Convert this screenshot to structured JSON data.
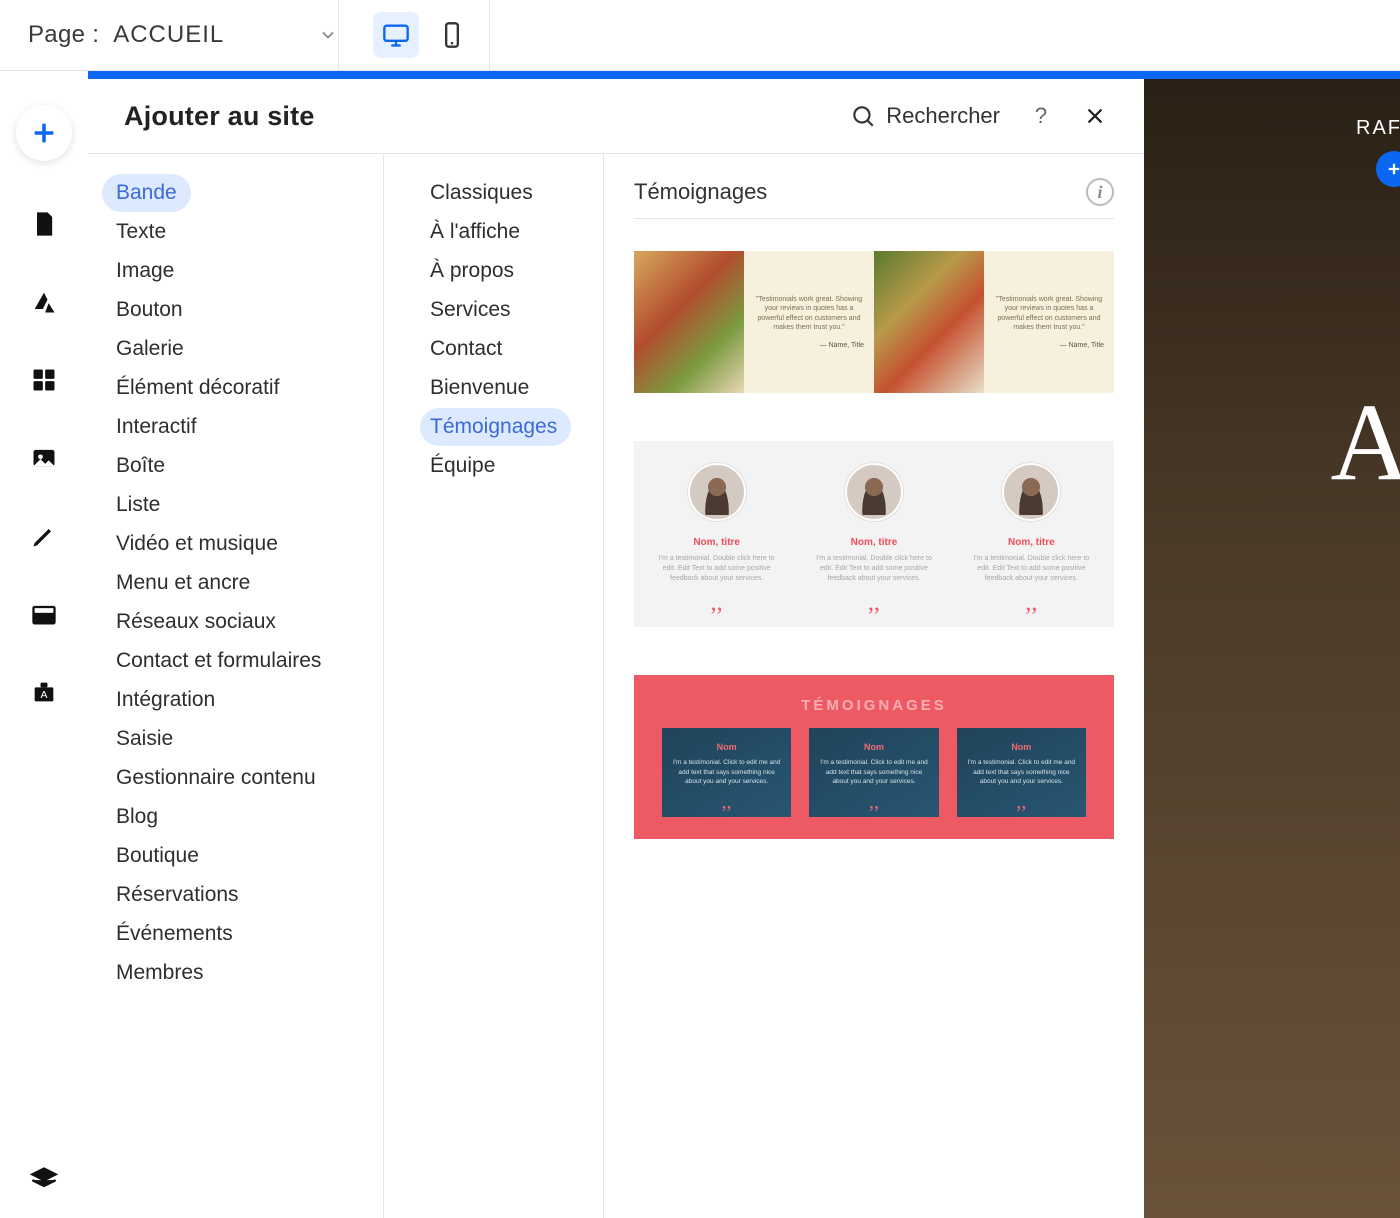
{
  "topbar": {
    "page_label": "Page :",
    "page_value": "ACCUEIL"
  },
  "panel": {
    "title": "Ajouter au site",
    "search_label": "Rechercher"
  },
  "categories": [
    "Bande",
    "Texte",
    "Image",
    "Bouton",
    "Galerie",
    "Élément décoratif",
    "Interactif",
    "Boîte",
    "Liste",
    "Vidéo et musique",
    "Menu et ancre",
    "Réseaux sociaux",
    "Contact et formulaires",
    "Intégration",
    "Saisie",
    "Gestionnaire contenu",
    "Blog",
    "Boutique",
    "Réservations",
    "Événements",
    "Membres"
  ],
  "active_category_index": 0,
  "subcategories": [
    "Classiques",
    "À l'affiche",
    "À propos",
    "Services",
    "Contact",
    "Bienvenue",
    "Témoignages",
    "Équipe"
  ],
  "active_sub_index": 6,
  "preview": {
    "title": "Témoignages",
    "preset1": {
      "quote": "\"Testimonials work great. Showing your reviews in quotes has a powerful effect on customers and makes them trust you.\"",
      "author": "— Name, Title"
    },
    "preset2": {
      "name_label": "Nom, titre",
      "body": "I'm a testimonial. Double click here to edit. Edit Text to add some positive feedback about your services."
    },
    "preset3": {
      "heading": "TÉMOIGNAGES",
      "name_label": "Nom",
      "body": "I'm a testimonial. Click to edit me and add text that says something nice about you and your services."
    }
  },
  "canvas_peek": {
    "text": "RAF",
    "glyph": "A"
  }
}
